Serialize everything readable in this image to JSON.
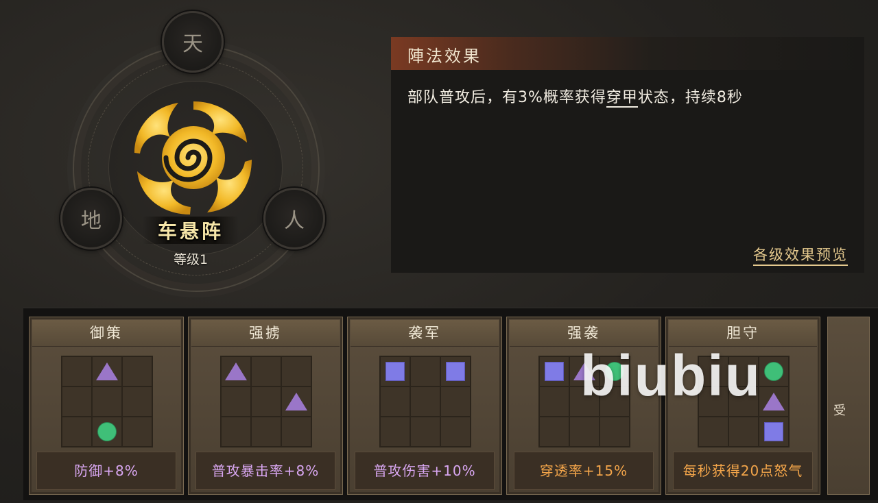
{
  "emblem": {
    "node_top": "天",
    "node_left": "地",
    "node_right": "人",
    "formation_name": "车悬阵",
    "level": "等级1",
    "swirl_color": "#f2b928"
  },
  "effect": {
    "title": "陣法效果",
    "desc_before": "部队普攻后，有3%概率获得",
    "desc_keyword": "穿甲",
    "desc_after": "状态，持续8秒",
    "preview_link": "各级效果预览"
  },
  "cards": [
    {
      "title": "御策",
      "bonus": "防御+8%",
      "bonus_color": "purple",
      "cells": [
        "",
        "tri",
        "",
        "",
        "",
        "",
        "",
        "dot",
        ""
      ]
    },
    {
      "title": "强掳",
      "bonus": "普攻暴击率+8%",
      "bonus_color": "purple",
      "cells": [
        "tri",
        "",
        "",
        "",
        "",
        "tri",
        "",
        "",
        ""
      ]
    },
    {
      "title": "袭军",
      "bonus": "普攻伤害+10%",
      "bonus_color": "purple",
      "cells": [
        "sq",
        "",
        "sq",
        "",
        "",
        "",
        "",
        "",
        ""
      ]
    },
    {
      "title": "强袭",
      "bonus": "穿透率+15%",
      "bonus_color": "orange",
      "cells": [
        "sq",
        "tri",
        "dot",
        "",
        "",
        "",
        "",
        "",
        ""
      ]
    },
    {
      "title": "胆守",
      "bonus": "每秒获得20点怒气",
      "bonus_color": "orange",
      "cells": [
        "",
        "",
        "dot",
        "",
        "",
        "tri",
        "",
        "",
        "sq"
      ]
    }
  ],
  "partial_card_text": "受",
  "watermark": "biubiu",
  "colors": {
    "triangle": "#9a76c8",
    "square": "#7f7be6",
    "circle": "#3fbf78",
    "bonus_purple": "#d9a7f2",
    "bonus_orange": "#f3a54a",
    "header_accent": "#7a3a22"
  }
}
